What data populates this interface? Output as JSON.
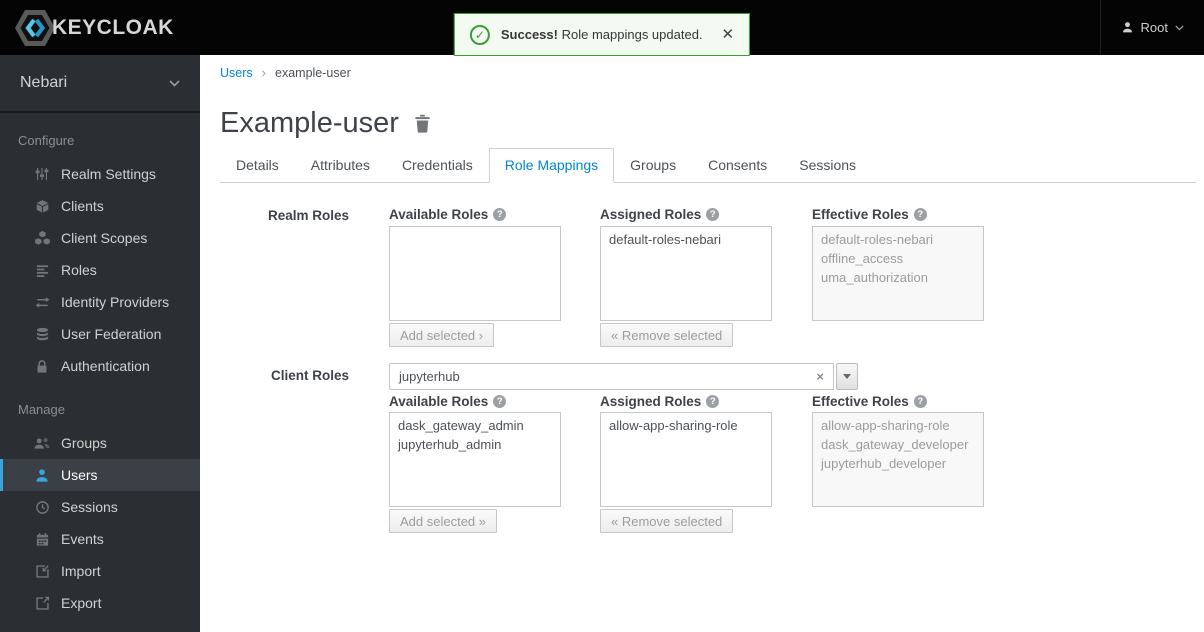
{
  "topbar": {
    "brand": "KEYCLOAK",
    "user_label": "Root"
  },
  "alert": {
    "title": "Success!",
    "message": "Role mappings updated.",
    "close_glyph": "✕"
  },
  "sidebar": {
    "realm": "Nebari",
    "configure_label": "Configure",
    "manage_label": "Manage",
    "configure_items": [
      {
        "label": "Realm Settings",
        "icon": "sliders-icon"
      },
      {
        "label": "Clients",
        "icon": "cube-icon"
      },
      {
        "label": "Client Scopes",
        "icon": "cubes-icon"
      },
      {
        "label": "Roles",
        "icon": "list-icon"
      },
      {
        "label": "Identity Providers",
        "icon": "exchange-arrows-icon"
      },
      {
        "label": "User Federation",
        "icon": "database-icon"
      },
      {
        "label": "Authentication",
        "icon": "lock-icon"
      }
    ],
    "manage_items": [
      {
        "label": "Groups",
        "icon": "groups-icon",
        "active": false
      },
      {
        "label": "Users",
        "icon": "user-icon",
        "active": true
      },
      {
        "label": "Sessions",
        "icon": "clock-icon",
        "active": false
      },
      {
        "label": "Events",
        "icon": "calendar-icon",
        "active": false
      },
      {
        "label": "Import",
        "icon": "import-icon",
        "active": false
      },
      {
        "label": "Export",
        "icon": "export-icon",
        "active": false
      }
    ]
  },
  "breadcrumb": {
    "parent": "Users",
    "separator": "›",
    "current": "example-user"
  },
  "page": {
    "title": "Example-user"
  },
  "tabs": [
    {
      "label": "Details",
      "active": false
    },
    {
      "label": "Attributes",
      "active": false
    },
    {
      "label": "Credentials",
      "active": false
    },
    {
      "label": "Role Mappings",
      "active": true
    },
    {
      "label": "Groups",
      "active": false
    },
    {
      "label": "Consents",
      "active": false
    },
    {
      "label": "Sessions",
      "active": false
    }
  ],
  "realm_roles": {
    "section_label": "Realm Roles",
    "available_label": "Available Roles",
    "assigned_label": "Assigned Roles",
    "effective_label": "Effective Roles",
    "available_items": [],
    "assigned_items": [
      "default-roles-nebari"
    ],
    "effective_items": [
      "default-roles-nebari",
      "offline_access",
      "uma_authorization"
    ],
    "add_button": "Add selected ›",
    "remove_button": "« Remove selected"
  },
  "client_roles": {
    "section_label": "Client Roles",
    "client_select_value": "jupyterhub",
    "available_label": "Available Roles",
    "assigned_label": "Assigned Roles",
    "effective_label": "Effective Roles",
    "available_items": [
      "dask_gateway_admin",
      "jupyterhub_admin"
    ],
    "assigned_items": [
      "allow-app-sharing-role"
    ],
    "effective_items": [
      "allow-app-sharing-role",
      "dask_gateway_developer",
      "jupyterhub_developer"
    ],
    "add_button": "Add selected »",
    "remove_button": "« Remove selected"
  },
  "colors": {
    "accent_blue": "#0088ce",
    "nav_active_blue": "#39a5dc",
    "success_green": "#3f9c35"
  }
}
